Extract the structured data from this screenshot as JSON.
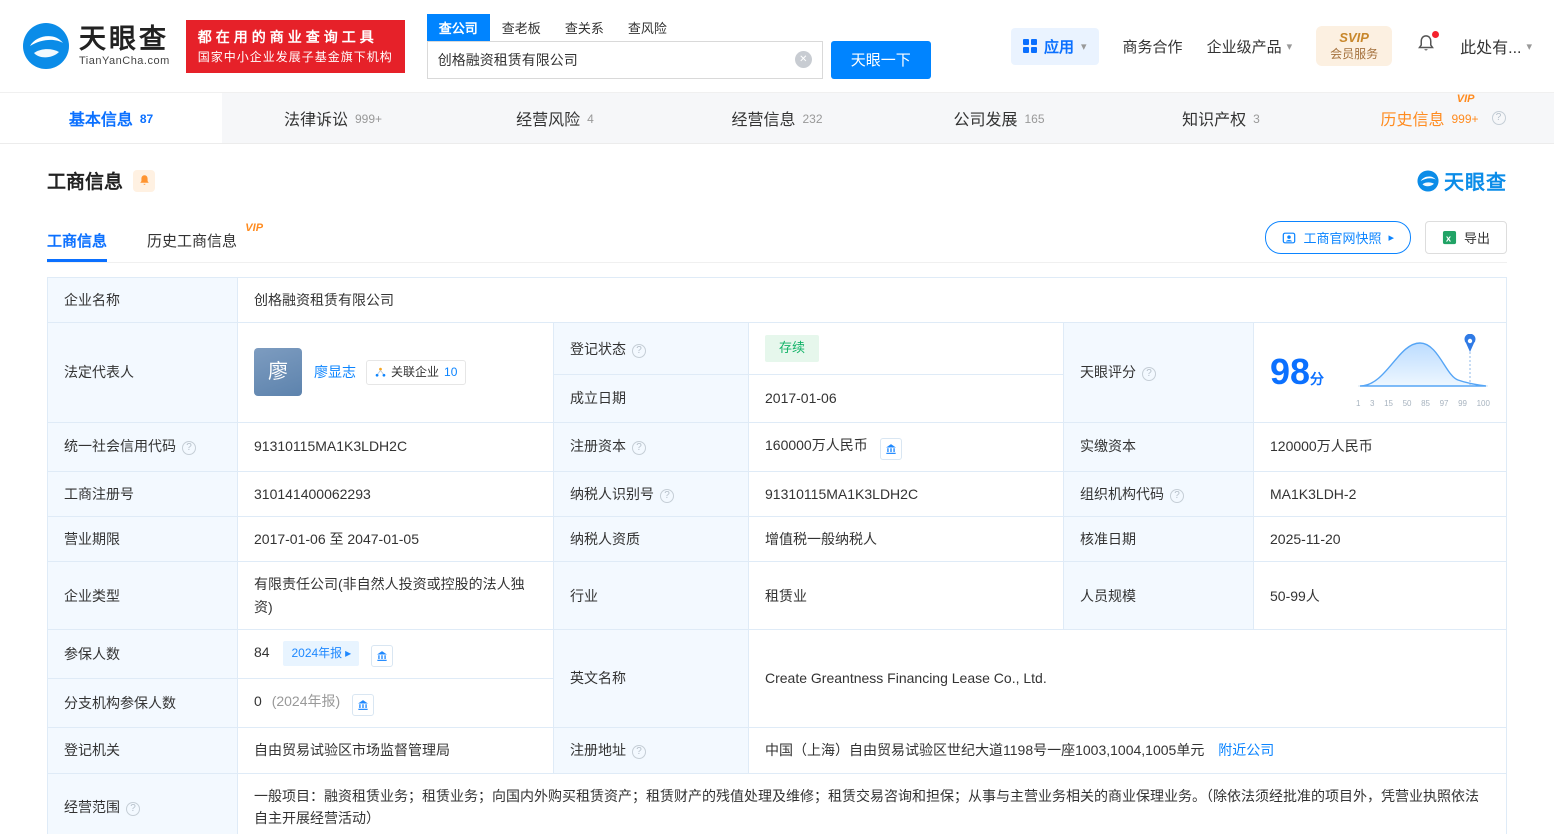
{
  "icons": {
    "help": "?",
    "caret_down": "▾",
    "caret_right": "▸",
    "clear": "✕"
  },
  "header": {
    "logo": {
      "brand": "天眼查",
      "domain": "TianYanCha.com"
    },
    "promo": {
      "line1": "都在用的商业查询工具",
      "line2": "国家中小企业发展子基金旗下机构"
    },
    "search": {
      "tabs": [
        {
          "label": "查公司"
        },
        {
          "label": "查老板"
        },
        {
          "label": "查关系"
        },
        {
          "label": "查风险"
        }
      ],
      "value": "创格融资租赁有限公司",
      "submit": "天眼一下"
    },
    "menu": {
      "apps": "应用",
      "biz": "商务合作",
      "enterprise": "企业级产品",
      "svip_top": "SVIP",
      "svip_bottom": "会员服务",
      "user": "此处有..."
    }
  },
  "nav_tabs": [
    {
      "label": "基本信息",
      "count": "87"
    },
    {
      "label": "法律诉讼",
      "count": "999+"
    },
    {
      "label": "经营风险",
      "count": "4"
    },
    {
      "label": "经营信息",
      "count": "232"
    },
    {
      "label": "公司发展",
      "count": "165"
    },
    {
      "label": "知识产权",
      "count": "3"
    },
    {
      "label": "历史信息",
      "count": "999+",
      "vip": "VIP"
    }
  ],
  "section": {
    "title": "工商信息",
    "brand": "天眼查",
    "subtabs": [
      {
        "label": "工商信息"
      },
      {
        "label": "历史工商信息",
        "vip": "VIP"
      }
    ],
    "snapshot_btn": "工商官网快照",
    "export_btn": "导出"
  },
  "info": {
    "company_name": {
      "label": "企业名称",
      "value": "创格融资租赁有限公司"
    },
    "legal_rep": {
      "label": "法定代表人",
      "avatar": "廖",
      "name": "廖显志",
      "related_label": "关联企业",
      "related_count": "10"
    },
    "reg_status": {
      "label": "登记状态",
      "value": "存续"
    },
    "establish_date": {
      "label": "成立日期",
      "value": "2017-01-06"
    },
    "score": {
      "label": "天眼评分",
      "value": "98",
      "unit": "分",
      "ticks": [
        "1",
        "3",
        "15",
        "50",
        "85",
        "97",
        "99",
        "100"
      ]
    },
    "credit_code": {
      "label": "统一社会信用代码",
      "value": "91310115MA1K3LDH2C"
    },
    "reg_capital": {
      "label": "注册资本",
      "value": "160000万人民币"
    },
    "paid_capital": {
      "label": "实缴资本",
      "value": "120000万人民币"
    },
    "reg_number": {
      "label": "工商注册号",
      "value": "310141400062293"
    },
    "taxpayer_id": {
      "label": "纳税人识别号",
      "value": "91310115MA1K3LDH2C"
    },
    "org_code": {
      "label": "组织机构代码",
      "value": "MA1K3LDH-2"
    },
    "business_term": {
      "label": "营业期限",
      "value": "2017-01-06 至 2047-01-05"
    },
    "taxpayer_quality": {
      "label": "纳税人资质",
      "value": "增值税一般纳税人"
    },
    "approval_date": {
      "label": "核准日期",
      "value": "2025-11-20"
    },
    "company_type": {
      "label": "企业类型",
      "value": "有限责任公司(非自然人投资或控股的法人独资)"
    },
    "industry": {
      "label": "行业",
      "value": "租赁业"
    },
    "staff_size": {
      "label": "人员规模",
      "value": "50-99人"
    },
    "insured_count": {
      "label": "参保人数",
      "value": "84",
      "report_badge": "2024年报"
    },
    "english_name": {
      "label": "英文名称",
      "value": "Create Greantness Financing Lease Co., Ltd."
    },
    "branch_insured": {
      "label": "分支机构参保人数",
      "value": "0",
      "report_note": "(2024年报)"
    },
    "reg_authority": {
      "label": "登记机关",
      "value": "自由贸易试验区市场监督管理局"
    },
    "reg_address": {
      "label": "注册地址",
      "value": "中国（上海）自由贸易试验区世纪大道1198号一座1003,1004,1005单元",
      "nearby_link": "附近公司"
    },
    "business_scope": {
      "label": "经营范围",
      "value": "一般项目：融资租赁业务；租赁业务；向国内外购买租赁资产；租赁财产的残值处理及维修；租赁交易咨询和担保；从事与主营业务相关的商业保理业务。（除依法须经批准的项目外，凭营业执照依法自主开展经营活动）"
    }
  }
}
